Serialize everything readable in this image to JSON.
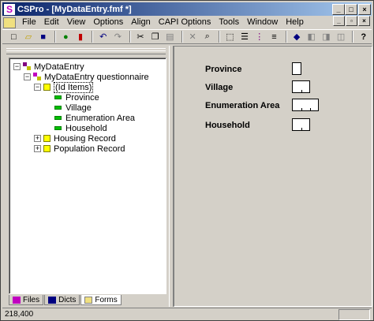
{
  "window": {
    "title": "CSPro - [MyDataEntry.fmf *]",
    "app_letter": "S"
  },
  "title_buttons": {
    "minimize": "_",
    "maximize": "□",
    "close": "×"
  },
  "mdi_buttons": {
    "minimize": "_",
    "restore": "▫",
    "close": "×"
  },
  "menu": [
    "File",
    "Edit",
    "View",
    "Options",
    "Align",
    "CAPI Options",
    "Tools",
    "Window",
    "Help"
  ],
  "toolbar": {
    "buttons": [
      {
        "name": "new-icon",
        "glyph": "□"
      },
      {
        "name": "open-icon",
        "glyph": "▱"
      },
      {
        "name": "save-icon",
        "glyph": "■"
      },
      {
        "name": "run-icon",
        "glyph": "●"
      },
      {
        "name": "traffic-light-icon",
        "glyph": "▮"
      },
      {
        "name": "undo-icon",
        "glyph": "↶"
      },
      {
        "name": "redo-icon",
        "glyph": "↷"
      },
      {
        "name": "cut-icon",
        "glyph": "✂"
      },
      {
        "name": "copy-icon",
        "glyph": "❐"
      },
      {
        "name": "paste-icon",
        "glyph": "▤"
      },
      {
        "name": "delete-icon",
        "glyph": "✕"
      },
      {
        "name": "find-icon",
        "glyph": "⌕"
      },
      {
        "name": "select-box-icon",
        "glyph": "⬚"
      },
      {
        "name": "align-icon",
        "glyph": "☰"
      },
      {
        "name": "grid-icon",
        "glyph": "⋮"
      },
      {
        "name": "list-icon",
        "glyph": "≡"
      },
      {
        "name": "book-icon",
        "glyph": "◆"
      },
      {
        "name": "cascade-icon",
        "glyph": "◧"
      },
      {
        "name": "tile-icon",
        "glyph": "◨"
      },
      {
        "name": "arrange-icon",
        "glyph": "◫"
      },
      {
        "name": "help-icon",
        "glyph": "?"
      }
    ]
  },
  "tree": {
    "root": "MyDataEntry",
    "questionnaire": "MyDataEntry questionnaire",
    "id_items": "(Id Items)",
    "items": [
      "Province",
      "Village",
      "Enumeration Area",
      "Household"
    ],
    "records": [
      "Housing Record",
      "Population Record"
    ]
  },
  "tabs": [
    "Files",
    "Dicts",
    "Forms"
  ],
  "form": {
    "fields": [
      {
        "label": "Province"
      },
      {
        "label": "Village"
      },
      {
        "label": "Enumeration Area"
      },
      {
        "label": "Household"
      }
    ]
  },
  "status": {
    "coords": "218,400"
  }
}
